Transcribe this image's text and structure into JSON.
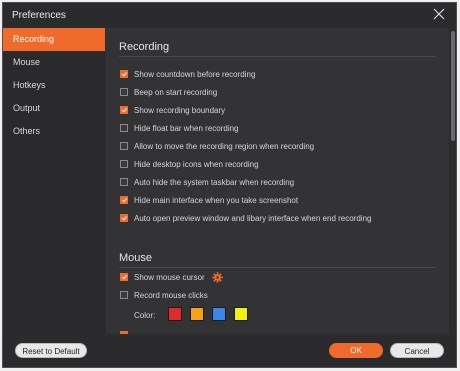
{
  "window": {
    "title": "Preferences"
  },
  "sidebar": {
    "items": [
      {
        "label": "Recording"
      },
      {
        "label": "Mouse"
      },
      {
        "label": "Hotkeys"
      },
      {
        "label": "Output"
      },
      {
        "label": "Others"
      }
    ],
    "active": "Recording"
  },
  "recording": {
    "title": "Recording",
    "options": [
      {
        "label": "Show countdown before recording",
        "checked": true
      },
      {
        "label": "Beep on start recording",
        "checked": false
      },
      {
        "label": "Show recording boundary",
        "checked": true
      },
      {
        "label": "Hide float bar when recording",
        "checked": false
      },
      {
        "label": "Allow to move the recording region when recording",
        "checked": false
      },
      {
        "label": "Hide desktop icons when recording",
        "checked": false
      },
      {
        "label": "Auto hide the system taskbar when recording",
        "checked": false
      },
      {
        "label": "Hide main interface when you take screenshot",
        "checked": true
      },
      {
        "label": "Auto open preview window and libary interface when end recording",
        "checked": true
      }
    ]
  },
  "mouse": {
    "title": "Mouse",
    "options": [
      {
        "label": "Show mouse cursor",
        "checked": true
      },
      {
        "label": "Record mouse clicks",
        "checked": false
      }
    ],
    "color_label": "Color:",
    "colors": [
      "#e02b2b",
      "#f7a21b",
      "#3a86e6",
      "#f2f20f"
    ]
  },
  "footer": {
    "reset_label": "Reset to Default",
    "ok_label": "OK",
    "cancel_label": "Cancel"
  },
  "theme": {
    "accent": "#f06a2b"
  }
}
